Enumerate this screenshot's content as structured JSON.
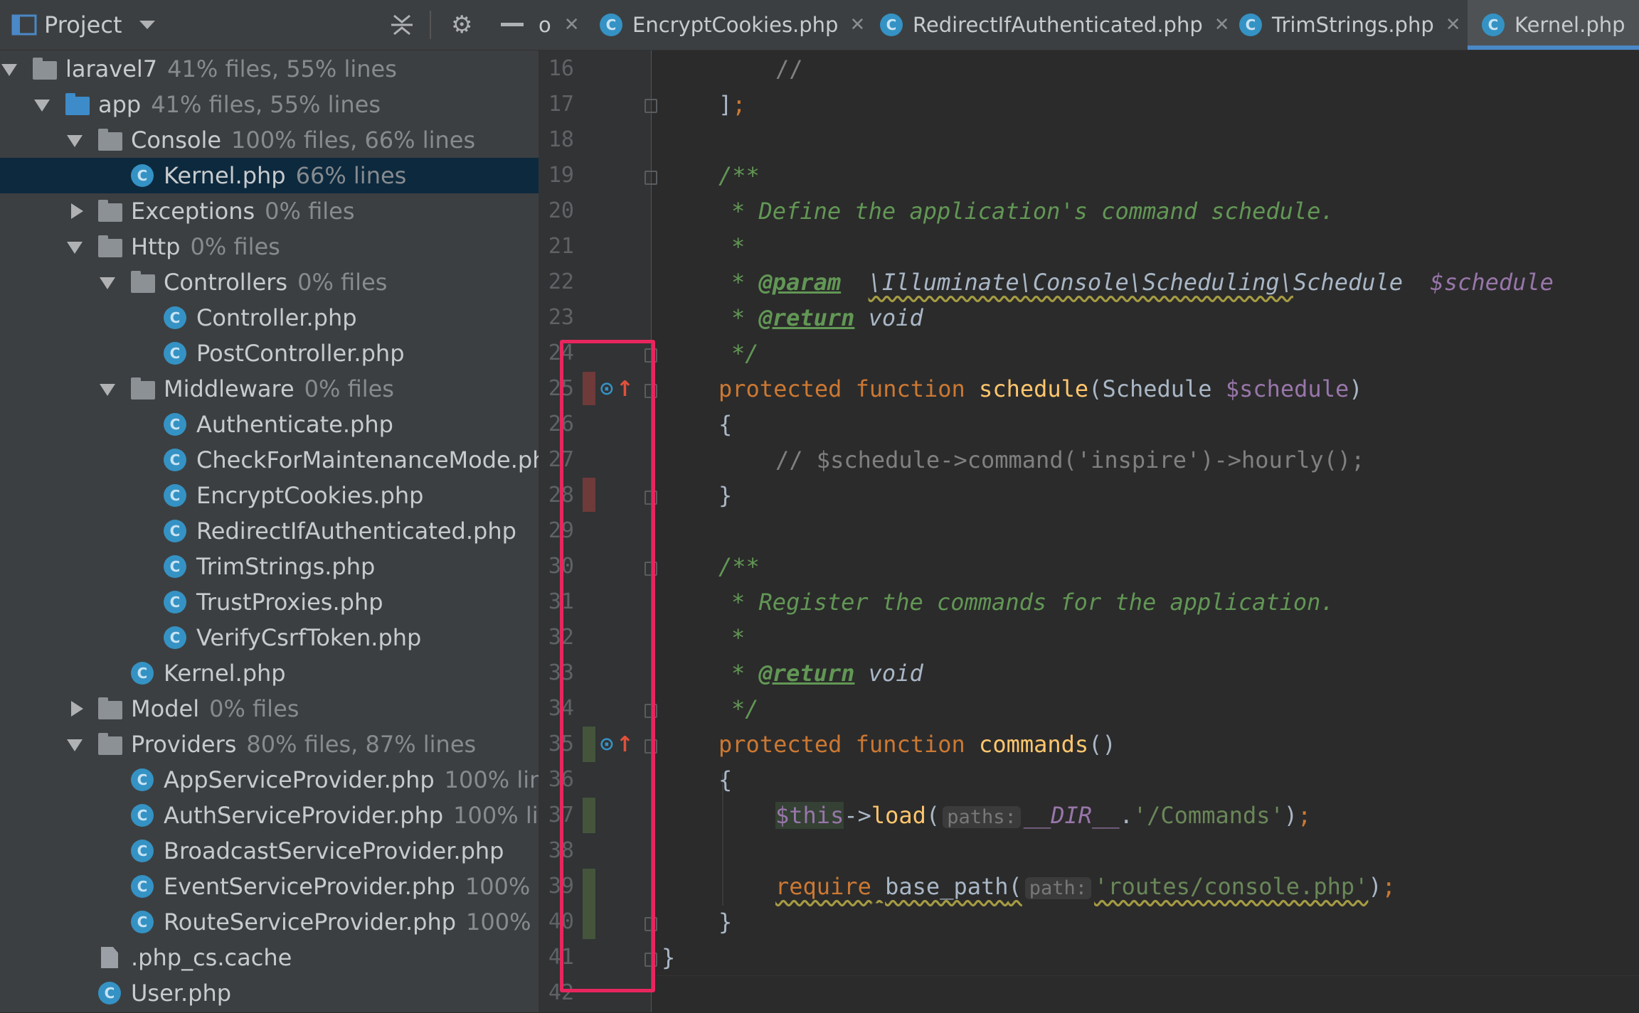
{
  "project_panel": {
    "title": "Project",
    "tree": [
      {
        "name": "laravel7",
        "coverage": "41% files, 55% lines",
        "level": 0,
        "kind": "folder",
        "state": "open"
      },
      {
        "name": "app",
        "coverage": "41% files, 55% lines",
        "level": 1,
        "kind": "folder-blue",
        "state": "open"
      },
      {
        "name": "Console",
        "coverage": "100% files, 66% lines",
        "level": 2,
        "kind": "folder",
        "state": "open"
      },
      {
        "name": "Kernel.php",
        "coverage": "66% lines",
        "level": 3,
        "kind": "class",
        "selected": true
      },
      {
        "name": "Exceptions",
        "coverage": "0% files",
        "level": 2,
        "kind": "folder",
        "state": "closed"
      },
      {
        "name": "Http",
        "coverage": "0% files",
        "level": 2,
        "kind": "folder",
        "state": "open"
      },
      {
        "name": "Controllers",
        "coverage": "0% files",
        "level": 3,
        "kind": "folder",
        "state": "open"
      },
      {
        "name": "Controller.php",
        "coverage": "",
        "level": 4,
        "kind": "class"
      },
      {
        "name": "PostController.php",
        "coverage": "",
        "level": 4,
        "kind": "class"
      },
      {
        "name": "Middleware",
        "coverage": "0% files",
        "level": 3,
        "kind": "folder",
        "state": "open"
      },
      {
        "name": "Authenticate.php",
        "coverage": "",
        "level": 4,
        "kind": "class"
      },
      {
        "name": "CheckForMaintenanceMode.ph",
        "coverage": "",
        "level": 4,
        "kind": "class"
      },
      {
        "name": "EncryptCookies.php",
        "coverage": "",
        "level": 4,
        "kind": "class"
      },
      {
        "name": "RedirectIfAuthenticated.php",
        "coverage": "",
        "level": 4,
        "kind": "class"
      },
      {
        "name": "TrimStrings.php",
        "coverage": "",
        "level": 4,
        "kind": "class"
      },
      {
        "name": "TrustProxies.php",
        "coverage": "",
        "level": 4,
        "kind": "class"
      },
      {
        "name": "VerifyCsrfToken.php",
        "coverage": "",
        "level": 4,
        "kind": "class"
      },
      {
        "name": "Kernel.php",
        "coverage": "",
        "level": 3,
        "kind": "class"
      },
      {
        "name": "Model",
        "coverage": "0% files",
        "level": 2,
        "kind": "folder",
        "state": "closed"
      },
      {
        "name": "Providers",
        "coverage": "80% files, 87% lines",
        "level": 2,
        "kind": "folder",
        "state": "open"
      },
      {
        "name": "AppServiceProvider.php",
        "coverage": "100% lin",
        "level": 3,
        "kind": "class"
      },
      {
        "name": "AuthServiceProvider.php",
        "coverage": "100% li",
        "level": 3,
        "kind": "class"
      },
      {
        "name": "BroadcastServiceProvider.php",
        "coverage": "",
        "level": 3,
        "kind": "class"
      },
      {
        "name": "EventServiceProvider.php",
        "coverage": "100% l",
        "level": 3,
        "kind": "class"
      },
      {
        "name": "RouteServiceProvider.php",
        "coverage": "100% l",
        "level": 3,
        "kind": "class"
      },
      {
        "name": ".php_cs.cache",
        "coverage": "",
        "level": 2,
        "kind": "file"
      },
      {
        "name": "User.php",
        "coverage": "",
        "level": 2,
        "kind": "class"
      }
    ]
  },
  "tabs": [
    {
      "label": "EncryptCookies.php",
      "active": false
    },
    {
      "label": "RedirectIfAuthenticated.php",
      "active": false
    },
    {
      "label": "TrimStrings.php",
      "active": false
    },
    {
      "label": "Kernel.php",
      "active": true
    }
  ],
  "tab_partial_prefix": "o",
  "class_icon_letter": "C",
  "editor": {
    "line_numbers": [
      "16",
      "17",
      "18",
      "19",
      "20",
      "21",
      "22",
      "23",
      "24",
      "25",
      "26",
      "27",
      "28",
      "29",
      "30",
      "31",
      "32",
      "33",
      "34",
      "35",
      "36",
      "37",
      "38",
      "39",
      "40",
      "41",
      "42"
    ],
    "lines": {
      "l16": "//",
      "l17a": "]",
      "l17b": ";",
      "l19": "/**",
      "l20": "* Define the application's command schedule.",
      "l21": "*",
      "l22_star": "* ",
      "l22_tag": "@param",
      "l22_ns": "\\Illuminate\\Console\\Scheduling\\",
      "l22_cls": "Schedule",
      "l22_var": "$schedule",
      "l23_star": "* ",
      "l23_tag": "@return",
      "l23_type": "void",
      "l24": "*/",
      "l25_kw1": "protected",
      "l25_kw2": "function",
      "l25_fn": "schedule",
      "l25_open": "(Schedule ",
      "l25_var": "$schedule",
      "l25_close": ")",
      "l26": "{",
      "l27": "// $schedule->command('inspire')->hourly();",
      "l28": "}",
      "l30": "/**",
      "l31": "* Register the commands for the application.",
      "l32": "*",
      "l33_star": "* ",
      "l33_tag": "@return",
      "l33_type": "void",
      "l34": "*/",
      "l35_kw1": "protected",
      "l35_kw2": "function",
      "l35_fn": "commands",
      "l35_paren": "()",
      "l36": "{",
      "l37_this": "$this",
      "l37_arrow": "->",
      "l37_fn": "load",
      "l37_open": "(",
      "l37_hint": "paths:",
      "l37_const": "__DIR__",
      "l37_dot": ".",
      "l37_str": "'/Commands'",
      "l37_close": ")",
      "l37_semi": ";",
      "l39_kw": "require",
      "l39_fn": "base_path",
      "l39_open": "(",
      "l39_hint": "path:",
      "l39_str": "'routes/console.php'",
      "l39_close": ")",
      "l39_semi": ";",
      "l40": "}",
      "l41": "}"
    }
  },
  "colors": {
    "highlight_box": "#e8265e",
    "deleted_marker": "#6f3a3a",
    "modified_marker": "#44553b",
    "active_tab_underline": "#4a88c7"
  }
}
